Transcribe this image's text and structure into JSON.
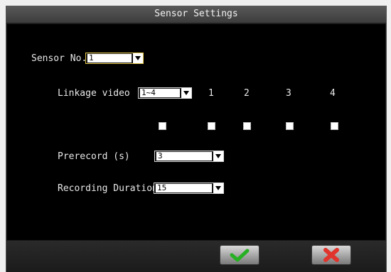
{
  "dialog": {
    "title": "Sensor Settings"
  },
  "sensor_no": {
    "label": "Sensor No.",
    "value": "1"
  },
  "linkage_video": {
    "label": "Linkage video",
    "range_value": "1~4",
    "channels": [
      "1",
      "2",
      "3",
      "4"
    ]
  },
  "prerecord": {
    "label": "Prerecord (s)",
    "value": "3"
  },
  "recording_duration": {
    "label": "Recording Duration",
    "value": "15"
  },
  "buttons": {
    "ok_icon": "check-icon",
    "cancel_icon": "x-icon"
  },
  "colors": {
    "ok": "#27b023",
    "cancel": "#e0342c",
    "highlight_border": "#e6c84a"
  }
}
